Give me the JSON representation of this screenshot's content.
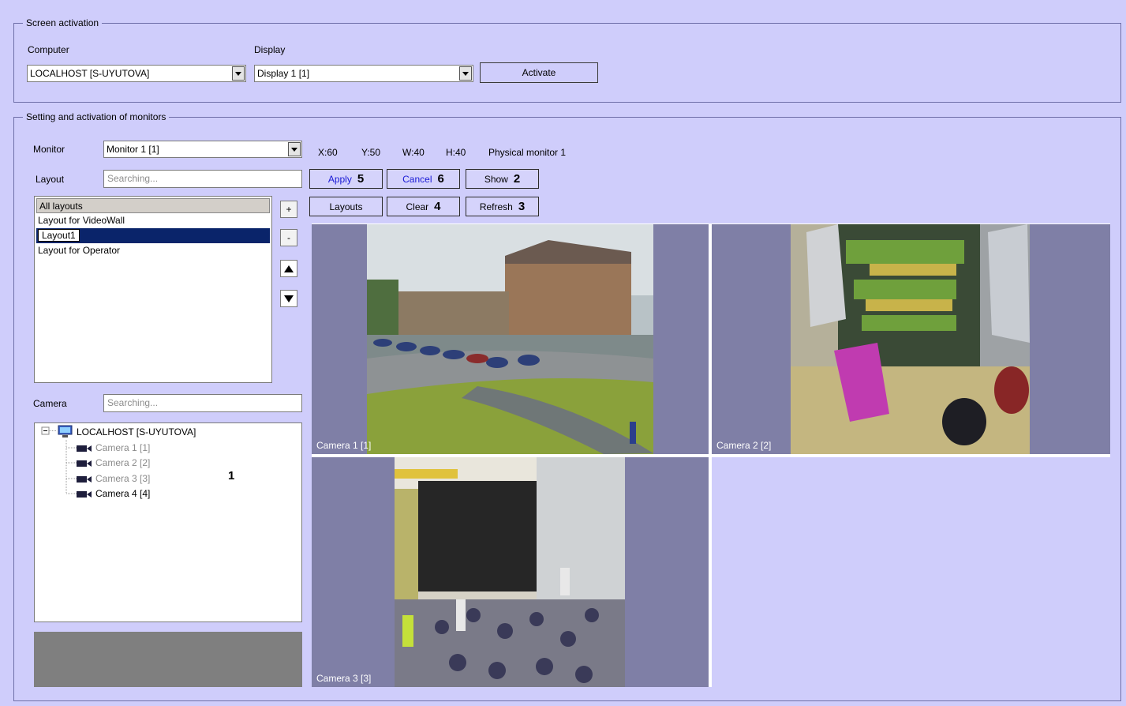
{
  "screen_activation": {
    "title": "Screen activation",
    "computer_label": "Computer",
    "computer_value": "LOCALHOST [S-UYUTOVA]",
    "display_label": "Display",
    "display_value": "Display 1 [1]",
    "activate_label": "Activate"
  },
  "monitors": {
    "title": "Setting and activation of monitors",
    "monitor_label": "Monitor",
    "monitor_value": "Monitor 1 [1]",
    "coords": {
      "x": "X:60",
      "y": "Y:50",
      "w": "W:40",
      "h": "H:40",
      "physical": "Physical monitor 1"
    },
    "layout_label": "Layout",
    "layout_placeholder": "Searching...",
    "layouts": [
      "All layouts",
      "Layout for VideoWall",
      "Layout1",
      "Layout for Operator"
    ],
    "camera_label": "Camera",
    "camera_placeholder": "Searching...",
    "tree": {
      "root": "LOCALHOST [S-UYUTOVA]",
      "cameras": [
        "Camera 1 [1]",
        "Camera 2 [2]",
        "Camera 3 [3]",
        "Camera 4 [4]"
      ]
    },
    "annotation_1": "1",
    "buttons": {
      "apply": "Apply",
      "apply_num": "5",
      "cancel": "Cancel",
      "cancel_num": "6",
      "show": "Show",
      "show_num": "2",
      "layouts": "Layouts",
      "clear": "Clear",
      "clear_num": "4",
      "refresh": "Refresh",
      "refresh_num": "3",
      "plus": "+",
      "minus": "-"
    },
    "grid": [
      "Camera 1 [1]",
      "Camera 2 [2]",
      "Camera 3 [3]"
    ]
  },
  "colors": {
    "background": "#cfcdfb",
    "cell": "#7f7fa6",
    "selection": "#0a246a",
    "accent_text": "#1a1ad6"
  }
}
